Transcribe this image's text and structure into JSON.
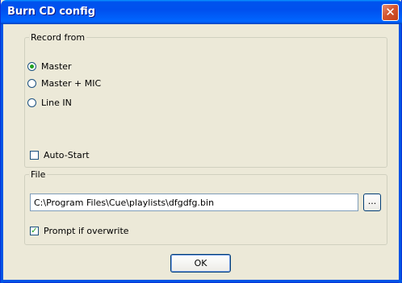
{
  "window": {
    "title": "Burn CD config",
    "close_glyph": "✕"
  },
  "record_group": {
    "legend": "Record from",
    "options": [
      {
        "label": "Master",
        "selected": true
      },
      {
        "label": "Master + MIC",
        "selected": false
      },
      {
        "label": "Line IN",
        "selected": false
      }
    ],
    "autostart": {
      "label": "Auto-Start",
      "checked": false
    }
  },
  "file_group": {
    "legend": "File",
    "path_value": "C:\\Program Files\\Cue\\playlists\\dfgdfg.bin",
    "browse_label": "...",
    "prompt_overwrite": {
      "label": "Prompt if overwrite",
      "checked": true,
      "mark": "✓"
    }
  },
  "ok_label": "OK",
  "colors": {
    "title_bar": "#0055E5",
    "dialog_bg": "#ECE9D8",
    "close_red": "#C13E17"
  }
}
